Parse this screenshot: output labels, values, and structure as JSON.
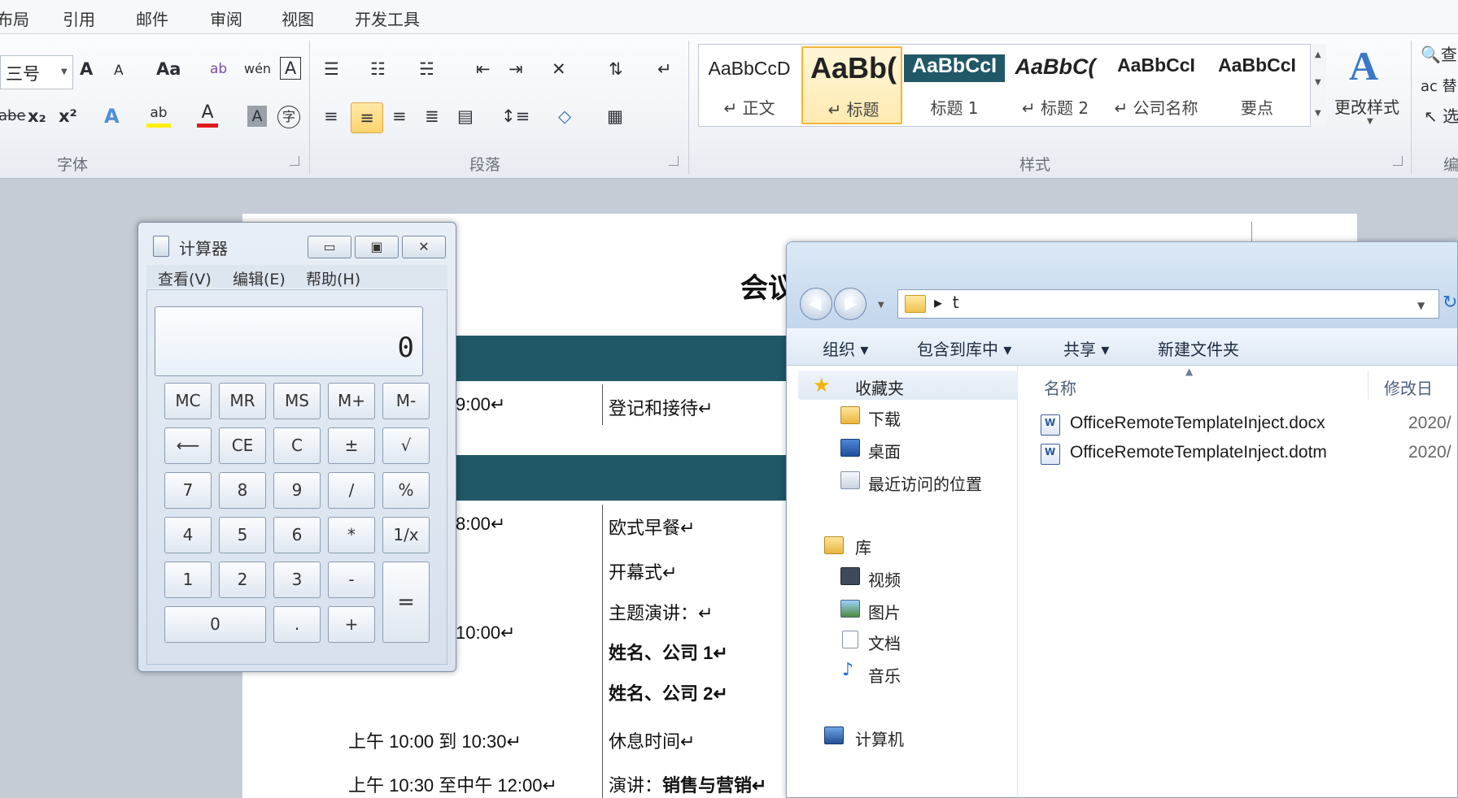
{
  "ribbon": {
    "tabs": [
      "布局",
      "引用",
      "邮件",
      "审阅",
      "视图",
      "开发工具"
    ],
    "font_size": "三号",
    "groups": {
      "font": "字体",
      "paragraph": "段落",
      "styles": "样式",
      "edit": "编"
    },
    "font_buttons": {
      "grow": "A",
      "shrink": "A",
      "case": "Aa",
      "pinyin": "wén",
      "border": "A",
      "strike": "abe",
      "sub": "x₂",
      "sup": "x²",
      "effects": "A",
      "highlight": "ab",
      "color": "A",
      "shade": "A",
      "circle": "字"
    },
    "styles": [
      {
        "sample": "AaBbCcD",
        "name": "↵ 正文"
      },
      {
        "sample": "AaBb(",
        "name": "↵ 标题"
      },
      {
        "sample": "AaBbCcI",
        "name": "标题 1"
      },
      {
        "sample": "AaBbC(",
        "name": "↵ 标题 2"
      },
      {
        "sample": "AaBbCcI",
        "name": "↵ 公司名称"
      },
      {
        "sample": "AaBbCcI",
        "name": "要点"
      }
    ],
    "change_styles": "更改样式",
    "edit_items": [
      "查",
      "替",
      "选"
    ]
  },
  "document": {
    "title": "会议",
    "rows": [
      {
        "time": "9:00↵",
        "item": "登记和接待↵"
      },
      {
        "time": "8:00↵",
        "item": "欧式早餐↵"
      },
      {
        "item": "开幕式↵"
      },
      {
        "time": "10:00↵",
        "item": "主题演讲：↵"
      },
      {
        "item": "姓名、公司 1↵"
      },
      {
        "item": "姓名、公司 2↵"
      },
      {
        "time": "上午 10:00 到 10:30↵",
        "item": "休息时间↵"
      },
      {
        "time": "上午 10:30 至中午 12:00↵",
        "item_prefix": "演讲：",
        "item": "销售与营销↵"
      }
    ],
    "band_color": "#205867"
  },
  "calculator": {
    "title": "计算器",
    "menu": [
      "查看(V)",
      "编辑(E)",
      "帮助(H)"
    ],
    "display": "0",
    "keys": [
      [
        "MC",
        "MR",
        "MS",
        "M+",
        "M-"
      ],
      [
        "⟵",
        "CE",
        "C",
        "±",
        "√"
      ],
      [
        "7",
        "8",
        "9",
        "/",
        "%"
      ],
      [
        "4",
        "5",
        "6",
        "*",
        "1/x"
      ],
      [
        "1",
        "2",
        "3",
        "-"
      ],
      [
        "0",
        ".",
        "+"
      ]
    ],
    "equals": "=",
    "caption": {
      "min": "▭",
      "max": "▣",
      "close": "✕"
    }
  },
  "explorer": {
    "path": "t",
    "toolbar": [
      "组织 ▾",
      "包含到库中 ▾",
      "共享 ▾",
      "新建文件夹"
    ],
    "favorites": {
      "header": "收藏夹",
      "items": [
        "下载",
        "桌面",
        "最近访问的位置"
      ]
    },
    "libraries": {
      "header": "库",
      "items": [
        "视频",
        "图片",
        "文档",
        "音乐"
      ]
    },
    "computer": "计算机",
    "columns": {
      "name": "名称",
      "modified": "修改日"
    },
    "files": [
      {
        "name": "OfficeRemoteTemplateInject.docx",
        "date": "2020/"
      },
      {
        "name": "OfficeRemoteTemplateInject.dotm",
        "date": "2020/"
      }
    ]
  }
}
